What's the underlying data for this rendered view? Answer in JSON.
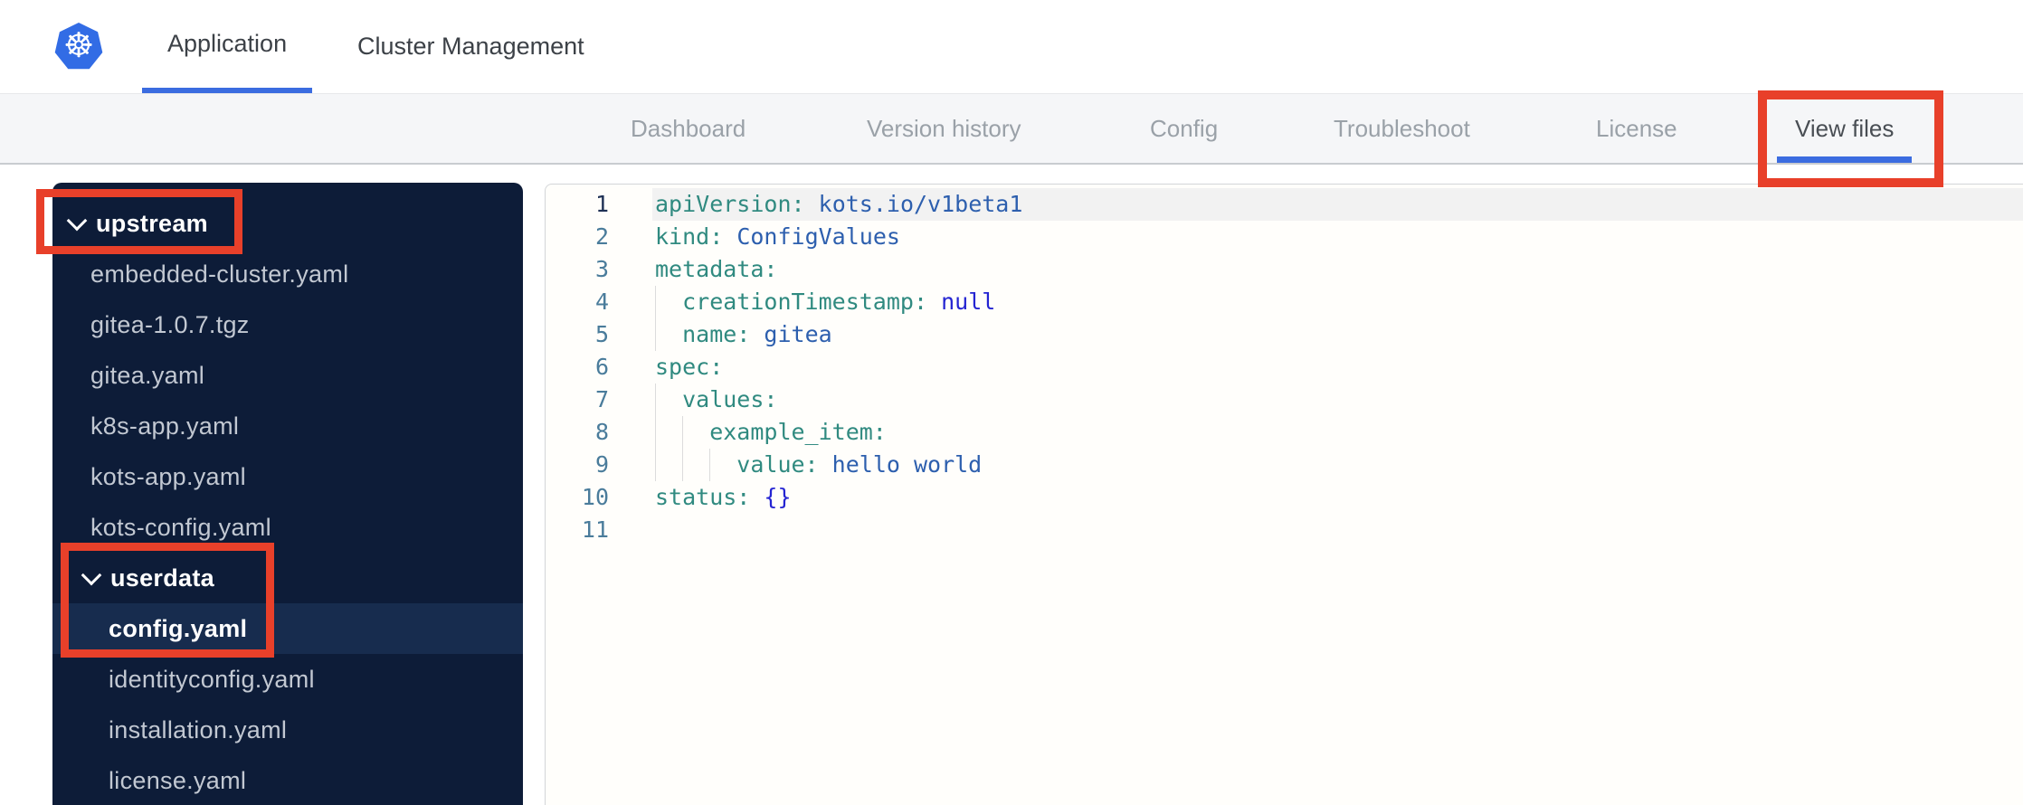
{
  "colors": {
    "k8s-blue": "#326ce5",
    "accent-blue": "#3b6ce0",
    "annotation-red": "#e8402a",
    "sidebar-bg": "#0d1c38",
    "sidebar-selected": "#172c4e",
    "key-teal": "#308a80",
    "value-blue": "#2d5fae",
    "literal-blue": "#2424d2"
  },
  "topbar": {
    "logo": "kubernetes-logo",
    "tabs": [
      {
        "label": "Application",
        "active": true
      },
      {
        "label": "Cluster Management",
        "active": false
      }
    ]
  },
  "subnav": {
    "items": [
      {
        "label": "Dashboard",
        "active": false
      },
      {
        "label": "Version history",
        "active": false
      },
      {
        "label": "Config",
        "active": false
      },
      {
        "label": "Troubleshoot",
        "active": false
      },
      {
        "label": "License",
        "active": false
      },
      {
        "label": "View files",
        "active": true
      }
    ]
  },
  "file_tree": {
    "items": [
      {
        "label": "upstream",
        "type": "folder",
        "level": 0,
        "expanded": true
      },
      {
        "label": "embedded-cluster.yaml",
        "type": "file",
        "level": 1
      },
      {
        "label": "gitea-1.0.7.tgz",
        "type": "file",
        "level": 1
      },
      {
        "label": "gitea.yaml",
        "type": "file",
        "level": 1
      },
      {
        "label": "k8s-app.yaml",
        "type": "file",
        "level": 1
      },
      {
        "label": "kots-app.yaml",
        "type": "file",
        "level": 1
      },
      {
        "label": "kots-config.yaml",
        "type": "file",
        "level": 1
      },
      {
        "label": "userdata",
        "type": "folder",
        "level": 1,
        "expanded": true
      },
      {
        "label": "config.yaml",
        "type": "file",
        "level": 2,
        "selected": true
      },
      {
        "label": "identityconfig.yaml",
        "type": "file",
        "level": 2
      },
      {
        "label": "installation.yaml",
        "type": "file",
        "level": 2
      },
      {
        "label": "license.yaml",
        "type": "file",
        "level": 2
      }
    ]
  },
  "editor": {
    "language": "yaml",
    "lines": [
      {
        "num": 1,
        "active": true,
        "indent": 0,
        "tokens": [
          {
            "t": "apiVersion:",
            "c": "key"
          },
          {
            "t": " ",
            "c": "plain"
          },
          {
            "t": "kots.io/v1beta1",
            "c": "val"
          }
        ]
      },
      {
        "num": 2,
        "indent": 0,
        "tokens": [
          {
            "t": "kind:",
            "c": "key"
          },
          {
            "t": " ",
            "c": "plain"
          },
          {
            "t": "ConfigValues",
            "c": "val"
          }
        ]
      },
      {
        "num": 3,
        "indent": 0,
        "tokens": [
          {
            "t": "metadata:",
            "c": "key"
          }
        ]
      },
      {
        "num": 4,
        "indent": 1,
        "tokens": [
          {
            "t": "creationTimestamp:",
            "c": "key"
          },
          {
            "t": " ",
            "c": "plain"
          },
          {
            "t": "null",
            "c": "lit"
          }
        ]
      },
      {
        "num": 5,
        "indent": 1,
        "tokens": [
          {
            "t": "name:",
            "c": "key"
          },
          {
            "t": " ",
            "c": "plain"
          },
          {
            "t": "gitea",
            "c": "val"
          }
        ]
      },
      {
        "num": 6,
        "indent": 0,
        "tokens": [
          {
            "t": "spec:",
            "c": "key"
          }
        ]
      },
      {
        "num": 7,
        "indent": 1,
        "tokens": [
          {
            "t": "values:",
            "c": "key"
          }
        ]
      },
      {
        "num": 8,
        "indent": 2,
        "tokens": [
          {
            "t": "example_item:",
            "c": "key"
          }
        ]
      },
      {
        "num": 9,
        "indent": 3,
        "tokens": [
          {
            "t": "value:",
            "c": "key"
          },
          {
            "t": " ",
            "c": "plain"
          },
          {
            "t": "hello world",
            "c": "val"
          }
        ]
      },
      {
        "num": 10,
        "indent": 0,
        "tokens": [
          {
            "t": "status:",
            "c": "key"
          },
          {
            "t": " ",
            "c": "plain"
          },
          {
            "t": "{}",
            "c": "lit"
          }
        ]
      },
      {
        "num": 11,
        "indent": 0,
        "tokens": []
      }
    ]
  },
  "annotations": {
    "color": "#e8402a",
    "boxes": [
      {
        "label": "upstream-folder"
      },
      {
        "label": "userdata-and-config-yaml"
      },
      {
        "label": "view-files-tab"
      }
    ]
  }
}
